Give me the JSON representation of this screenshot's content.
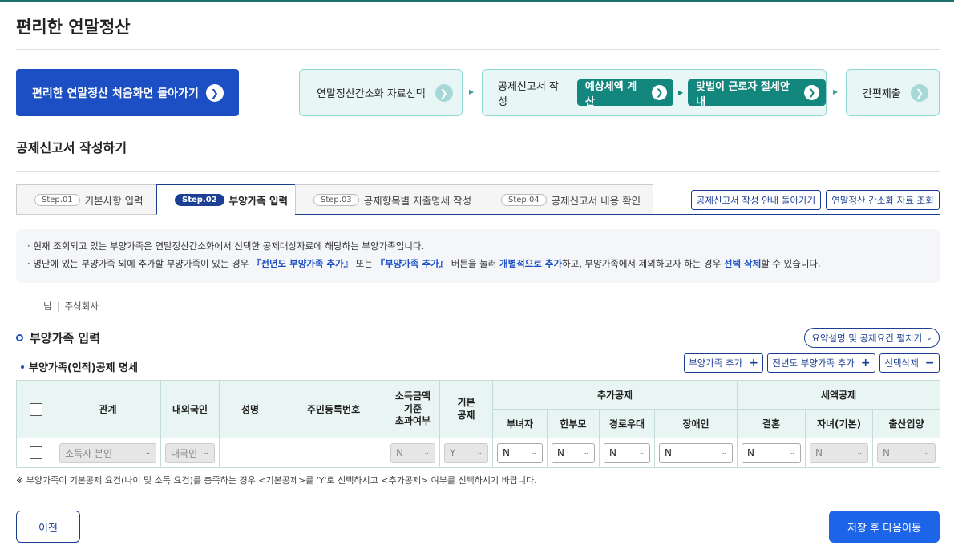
{
  "page_title": "편리한 연말정산",
  "home_button": "편리한 연말정산 처음화면 돌아가기",
  "flow": {
    "step1": "연말정산간소화 자료선택",
    "step2": "공제신고서 작성",
    "step2_btn1": "예상세액 계산",
    "step2_btn2": "맞벌이 근로자 절세안내",
    "step3": "간편제출"
  },
  "section_title": "공제신고서 작성하기",
  "tabs": [
    {
      "badge": "Step.01",
      "label": "기본사항 입력"
    },
    {
      "badge": "Step.02",
      "label": "부양가족 입력"
    },
    {
      "badge": "Step.03",
      "label": "공제항목별 지출명세 작성"
    },
    {
      "badge": "Step.04",
      "label": "공제신고서 내용 확인"
    }
  ],
  "links": {
    "guide_back": "공제신고서 작성 안내 돌아가기",
    "simplified_lookup": "연말정산 간소화 자료 조회"
  },
  "notice": {
    "line1": "현재 조회되고 있는 부양가족은 연말정산간소화에서 선택한 공제대상자료에 해당하는 부양가족입니다.",
    "line2_a": "명단에 있는 부양가족 외에 추가할 부양가족이 있는 경우 ",
    "line2_b": "『전년도 부양가족 추가』",
    "line2_c": " 또는 ",
    "line2_d": "『부양가족 추가』",
    "line2_e": " 버튼을 눌러 ",
    "line2_f": "개별적으로 추가",
    "line2_g": "하고, 부양가족에서 제외하고자 하는 경우 ",
    "line2_h": "선택 삭제",
    "line2_i": "할 수 있습니다."
  },
  "user": {
    "suffix": "님",
    "company": "주식회사"
  },
  "sub_title": "부양가족 입력",
  "summary_btn": "요약설명 및 공제요건 펼치기",
  "table_title": "부양가족(인적)공제 명세",
  "actions": {
    "add": "부양가족 추가",
    "add_prev": "전년도 부양가족 추가",
    "delete": "선택삭제"
  },
  "table": {
    "headers": {
      "relation": "관계",
      "nationality": "내외국인",
      "name": "성명",
      "resident_no": "주민등록번호",
      "income_over_1": "소득금액",
      "income_over_2": "기준",
      "income_over_3": "초과여부",
      "basic_1": "기본",
      "basic_2": "공제",
      "additional": "추가공제",
      "tax_credit": "세액공제",
      "single_woman": "부녀자",
      "single_parent": "한부모",
      "elderly": "경로우대",
      "disabled": "장애인",
      "marriage": "결혼",
      "children": "자녀(기본)",
      "birth_adopt": "출산입양"
    },
    "row": {
      "relation": "소득자 본인",
      "nationality": "내국인",
      "income_over": "N",
      "basic": "Y",
      "single_woman": "N",
      "single_parent": "N",
      "elderly": "N",
      "disabled": "N",
      "marriage": "N",
      "children": "N",
      "birth_adopt": "N"
    }
  },
  "footnote": "※ 부양가족이 기본공제 요건(나이 및 소득 요건)를 충족하는 경우 <기본공제>를 'Y'로 선택하시고 <추가공제> 여부를 선택하시기 바랍니다.",
  "buttons": {
    "prev": "이전",
    "next": "저장 후 다음이동"
  },
  "icons": {
    "arrow": "chevron-right-icon",
    "plus": "plus-icon",
    "minus": "minus-icon"
  }
}
